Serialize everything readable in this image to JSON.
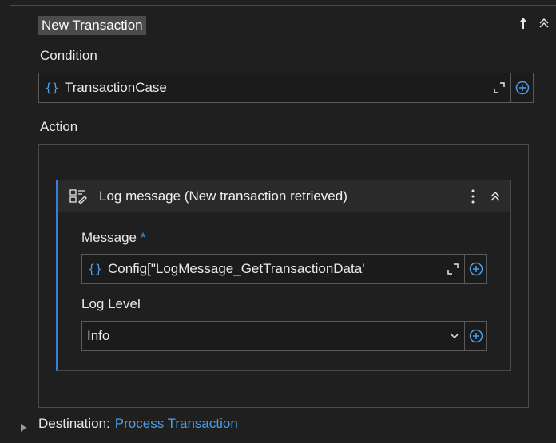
{
  "activity": {
    "title": "New Transaction"
  },
  "condition": {
    "label": "Condition",
    "value": "TransactionCase"
  },
  "action": {
    "label": "Action",
    "card": {
      "title": "Log message (New transaction retrieved)",
      "message_label": "Message",
      "message_required": "*",
      "message_value": "Config[\"LogMessage_GetTransactionData'",
      "loglevel_label": "Log Level",
      "loglevel_value": "Info"
    }
  },
  "destination": {
    "label": "Destination:",
    "target": "Process Transaction"
  },
  "colors": {
    "accent": "#4a9fe8",
    "background": "#1f1f1f",
    "field_bg": "#1b1b1b",
    "border": "#5a5a5a"
  },
  "icons": [
    "up-arrow-icon",
    "collapse-icon",
    "expand-icon",
    "plus-circle-icon",
    "log-message-icon",
    "kebab-menu-icon",
    "dropdown-arrow-icon",
    "play-arrow-icon"
  ]
}
